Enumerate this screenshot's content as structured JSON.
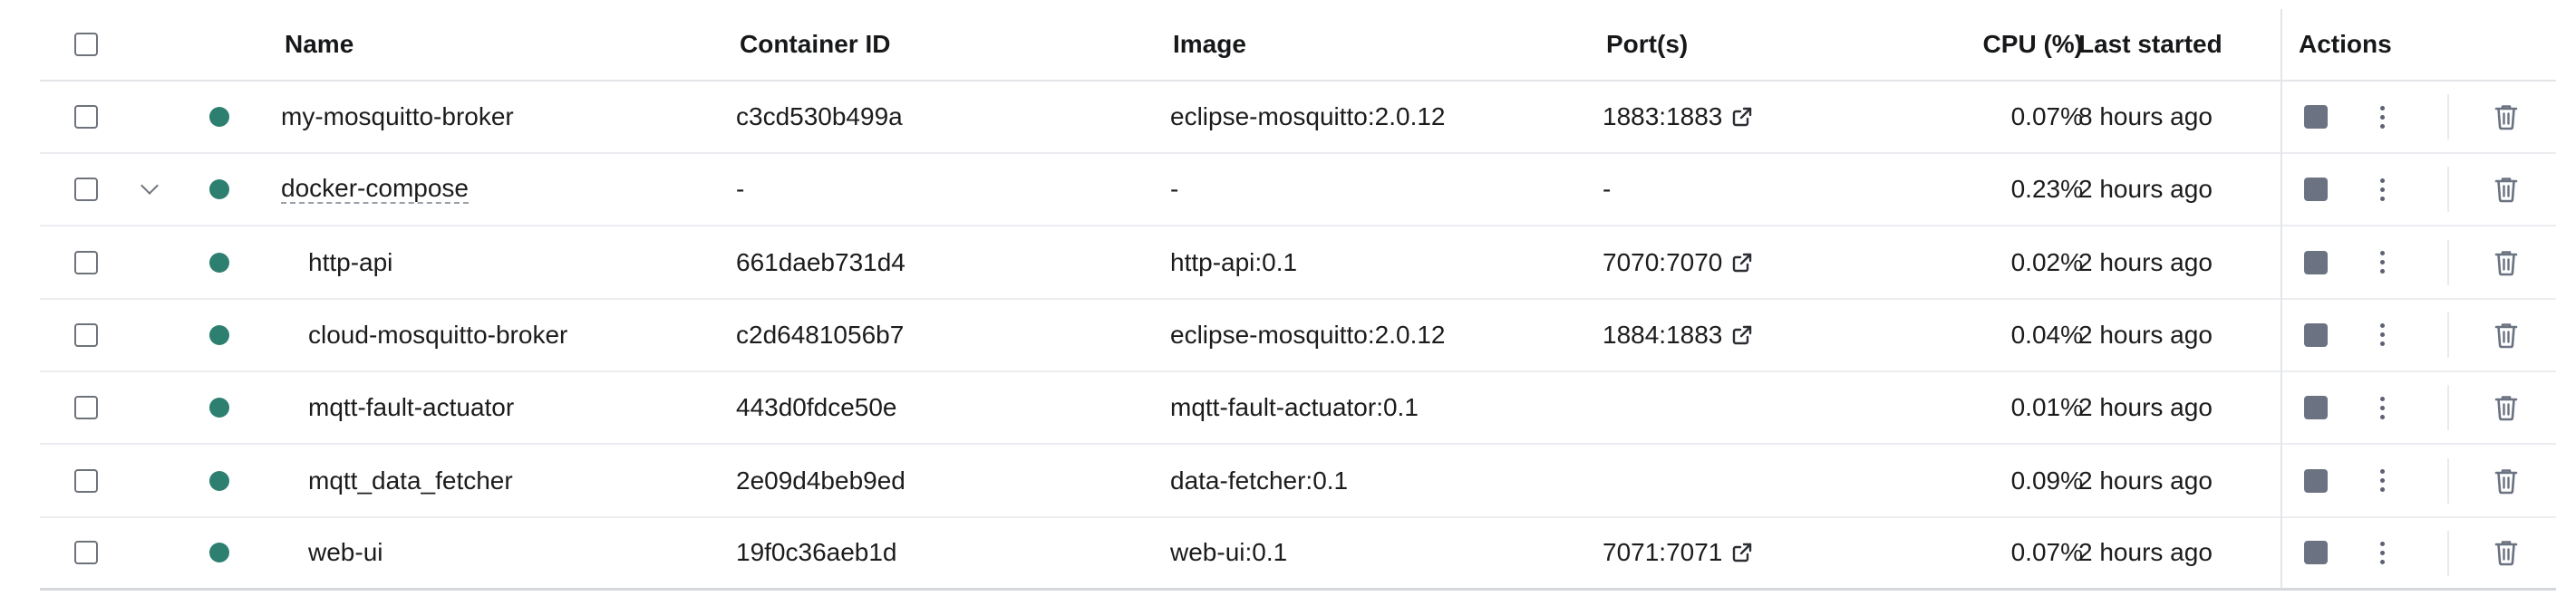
{
  "columns": {
    "name": "Name",
    "container_id": "Container ID",
    "image": "Image",
    "ports": "Port(s)",
    "cpu": "CPU (%)",
    "last_started": "Last started",
    "actions": "Actions"
  },
  "rows": [
    {
      "name": "my-mosquitto-broker",
      "container_id": "c3cd530b499a",
      "image": "eclipse-mosquitto:2.0.12",
      "ports": "1883:1883",
      "has_port_link": true,
      "cpu": "0.07%",
      "last_started": "8 hours ago",
      "indent": false,
      "expandable": false
    },
    {
      "name": "docker-compose",
      "container_id": "-",
      "image": "-",
      "ports": "-",
      "has_port_link": false,
      "cpu": "0.23%",
      "last_started": "2 hours ago",
      "indent": false,
      "expandable": true
    },
    {
      "name": "http-api",
      "container_id": "661daeb731d4",
      "image": "http-api:0.1",
      "ports": "7070:7070",
      "has_port_link": true,
      "cpu": "0.02%",
      "last_started": "2 hours ago",
      "indent": true,
      "expandable": false
    },
    {
      "name": "cloud-mosquitto-broker",
      "container_id": "c2d6481056b7",
      "image": "eclipse-mosquitto:2.0.12",
      "ports": "1884:1883",
      "has_port_link": true,
      "cpu": "0.04%",
      "last_started": "2 hours ago",
      "indent": true,
      "expandable": false
    },
    {
      "name": "mqtt-fault-actuator",
      "container_id": "443d0fdce50e",
      "image": "mqtt-fault-actuator:0.1",
      "ports": "",
      "has_port_link": false,
      "cpu": "0.01%",
      "last_started": "2 hours ago",
      "indent": true,
      "expandable": false
    },
    {
      "name": "mqtt_data_fetcher",
      "container_id": "2e09d4beb9ed",
      "image": "data-fetcher:0.1",
      "ports": "",
      "has_port_link": false,
      "cpu": "0.09%",
      "last_started": "2 hours ago",
      "indent": true,
      "expandable": false
    },
    {
      "name": "web-ui",
      "container_id": "19f0c36aeb1d",
      "image": "web-ui:0.1",
      "ports": "7071:7071",
      "has_port_link": true,
      "cpu": "0.07%",
      "last_started": "2 hours ago",
      "indent": true,
      "expandable": false
    }
  ],
  "status_color": "#2d7f70",
  "icons": {
    "select_all": "checkbox-icon",
    "status": "running-status-dot",
    "expand": "chevron-down-icon",
    "port_link": "external-link-icon",
    "stop": "stop-icon",
    "more": "kebab-menu-icon",
    "delete": "trash-icon"
  }
}
